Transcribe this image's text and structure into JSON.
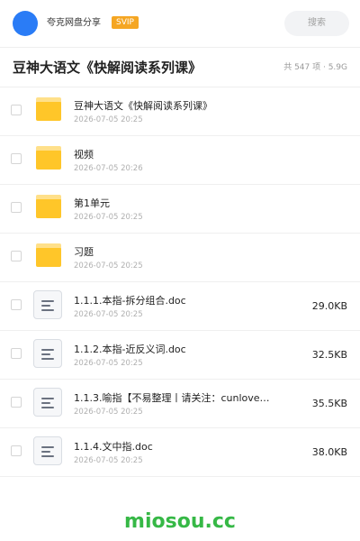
{
  "header": {
    "sharer_name": "夸克网盘分享",
    "badge": "SVIP",
    "search_placeholder": "搜索"
  },
  "title_bar": {
    "title": "豆神大语文《快解阅读系列课》",
    "summary": "共 547 项 · 5.9G"
  },
  "files": [
    {
      "type": "folder",
      "name": "豆神大语文《快解阅读系列课》",
      "date": "2026-07-05 20:25",
      "size": ""
    },
    {
      "type": "folder",
      "name": "视频",
      "date": "2026-07-05 20:26",
      "size": ""
    },
    {
      "type": "folder",
      "name": "第1单元",
      "date": "2026-07-05 20:25",
      "size": ""
    },
    {
      "type": "folder",
      "name": "习题",
      "date": "2026-07-05 20:25",
      "size": ""
    },
    {
      "type": "doc",
      "name": "1.1.1.本指-拆分组合.doc",
      "date": "2026-07-05 20:25",
      "size": "29.0KB"
    },
    {
      "type": "doc",
      "name": "1.1.2.本指-近反义词.doc",
      "date": "2026-07-05 20:25",
      "size": "32.5KB"
    },
    {
      "type": "doc",
      "name": "1.1.3.喻指【不易整理丨请关注：cunlove…",
      "date": "2026-07-05 20:25",
      "size": "35.5KB"
    },
    {
      "type": "doc",
      "name": "1.1.4.文中指.doc",
      "date": "2026-07-05 20:25",
      "size": "38.0KB"
    }
  ],
  "watermark": "miosou.cc",
  "colors": {
    "avatar": "#2a7cf6",
    "badge": "#f5a623",
    "folder": "#ffc629",
    "watermark": "#36b846"
  }
}
